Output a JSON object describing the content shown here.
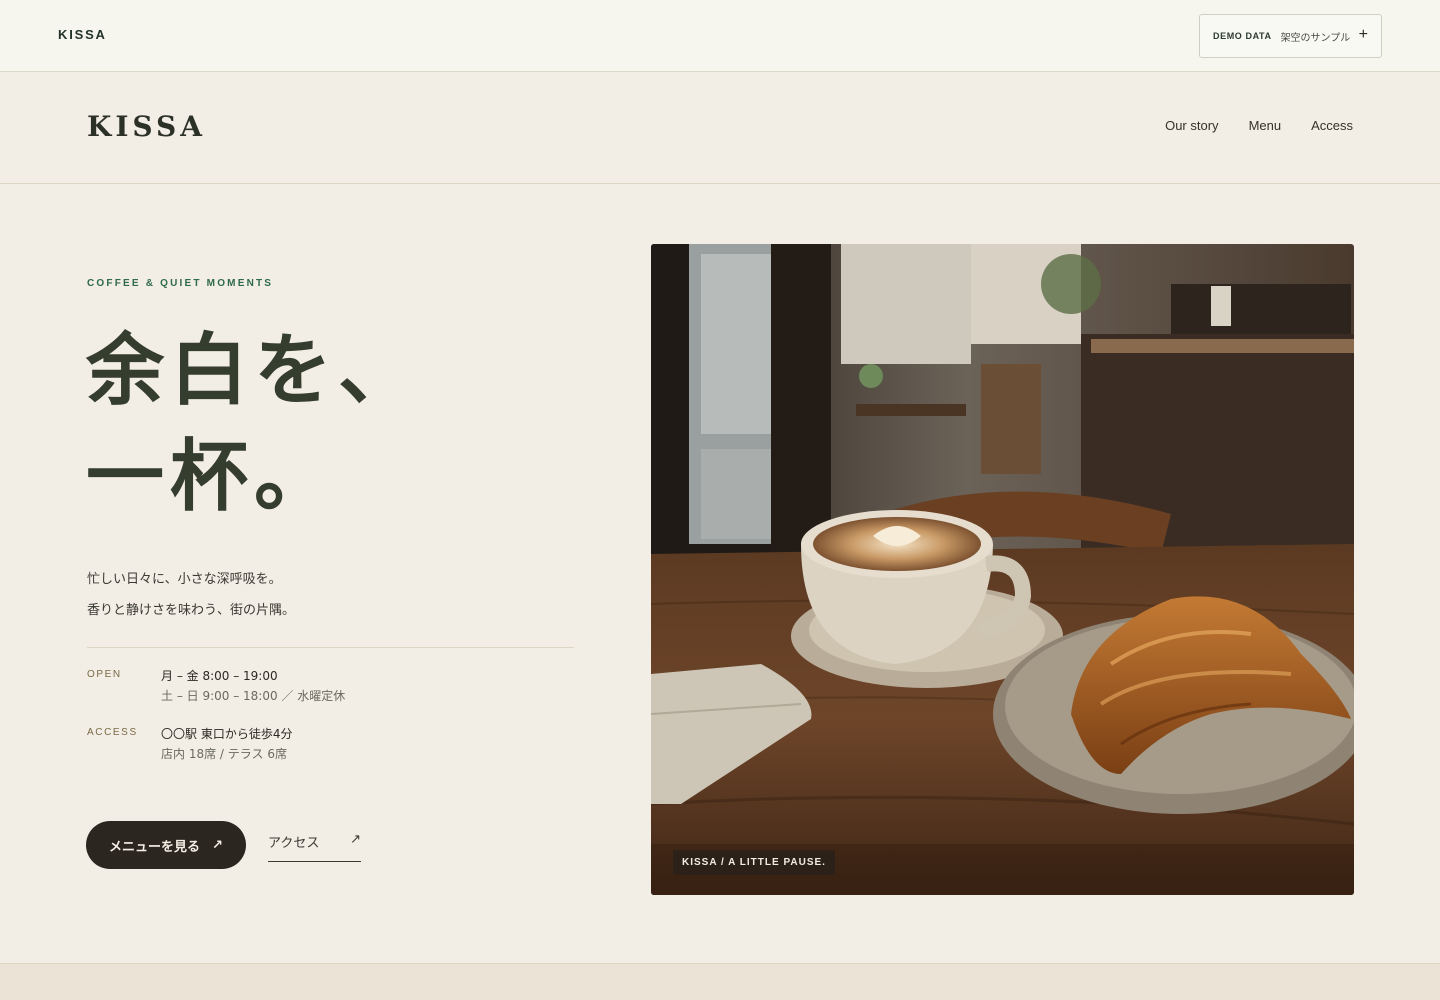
{
  "demo_bar": {
    "brand": "KISSA",
    "chip_tag": "DEMO DATA",
    "chip_label": "架空のサンプル",
    "chip_icon": "plus-icon",
    "chip_symbol": "+"
  },
  "header": {
    "logo": "KISSA",
    "nav": [
      "Our story",
      "Menu",
      "Access"
    ]
  },
  "hero": {
    "eyebrow": "COFFEE & QUIET MOMENTS",
    "title_lines": [
      "余白を、",
      "一杯。"
    ],
    "lead_lines": [
      "忙しい日々に、小さな深呼吸を。",
      "香りと静けさを味わう、街の片隅。"
    ],
    "info": [
      {
        "label": "OPEN",
        "line1": "月 – 金 8:00 – 19:00",
        "line2": "土 – 日 9:00 – 18:00 ／ 水曜定休"
      },
      {
        "label": "ACCESS",
        "line1": "〇〇駅 東口から徒歩4分",
        "line2": "店内 18席 / テラス 6席"
      }
    ],
    "primary_button": "メニューを見る",
    "secondary_link": "アクセス",
    "arrow_icon": "arrow-up-right-icon",
    "arrow_symbol": "↗"
  },
  "photo": {
    "caption": "KISSA / A LITTLE PAUSE."
  },
  "colors": {
    "background": "#f2ede5",
    "accent_green": "#2e6b48",
    "button_dark": "#2b2620"
  }
}
